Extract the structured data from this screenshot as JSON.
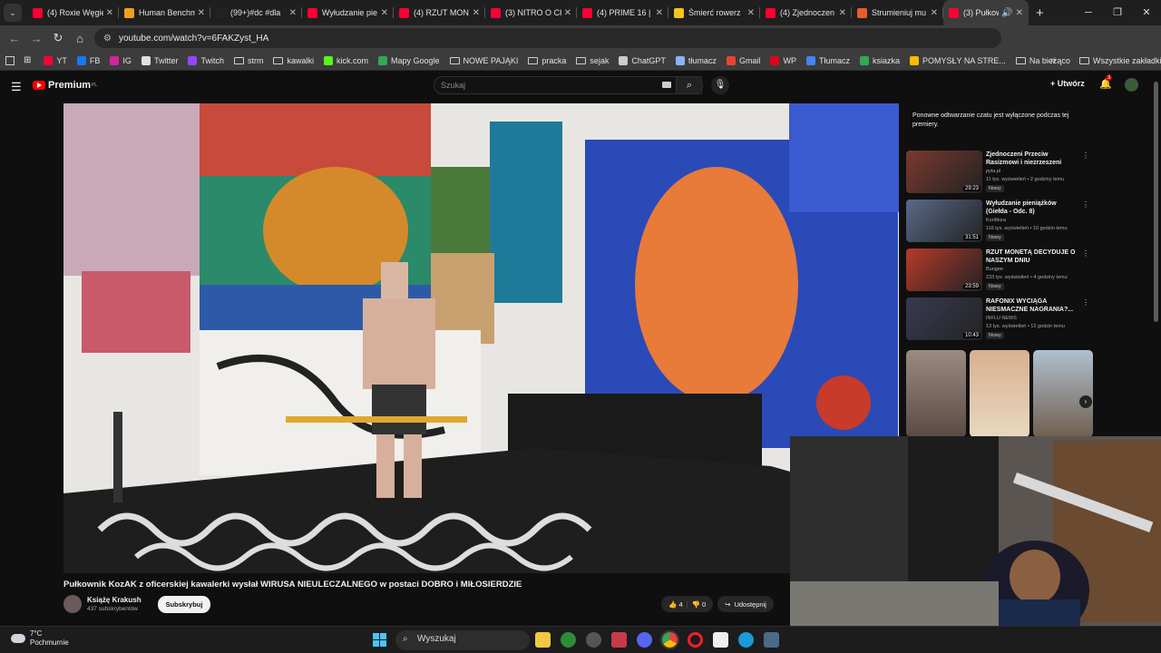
{
  "browser": {
    "tabs": [
      {
        "title": "(4) Roxie Węgie",
        "color": "#ff0033"
      },
      {
        "title": "Human Benchm",
        "color": "#f0a020"
      },
      {
        "title": "(99+)#dc #dla",
        "color": "#222222"
      },
      {
        "title": "Wyłudzanie pie",
        "color": "#ff0033"
      },
      {
        "title": "(4) RZUT MON",
        "color": "#ff0033"
      },
      {
        "title": "(3) NITRO O CH",
        "color": "#ff0033"
      },
      {
        "title": "(4) PRIME 16 |",
        "color": "#ff0033"
      },
      {
        "title": "Śmierć rowerz",
        "color": "#f5c518"
      },
      {
        "title": "(4) Zjednoczen",
        "color": "#ff0033"
      },
      {
        "title": "Strumieniuj mu",
        "color": "#e85d2a"
      },
      {
        "title": "(3) Pułkow",
        "color": "#ff0033"
      }
    ],
    "url": "youtube.com/watch?v=6FAKZyst_HA",
    "bookmarks": [
      {
        "label": "YT",
        "type": "icon",
        "color": "#ff0033"
      },
      {
        "label": "FB",
        "type": "icon",
        "color": "#1877f2"
      },
      {
        "label": "IG",
        "type": "icon",
        "color": "#d6249f"
      },
      {
        "label": "Twitter",
        "type": "icon",
        "color": "#e0e0e0"
      },
      {
        "label": "Twitch",
        "type": "icon",
        "color": "#9146ff"
      },
      {
        "label": "strm",
        "type": "folder"
      },
      {
        "label": "kawalki",
        "type": "folder"
      },
      {
        "label": "kick.com",
        "type": "icon",
        "color": "#53fc18"
      },
      {
        "label": "Mapy Google",
        "type": "icon",
        "color": "#34a853"
      },
      {
        "label": "NOWE PAJĄKI",
        "type": "folder"
      },
      {
        "label": "pracka",
        "type": "folder"
      },
      {
        "label": "sejak",
        "type": "folder"
      },
      {
        "label": "ChatGPT",
        "type": "icon",
        "color": "#cccccc"
      },
      {
        "label": "tłumacz",
        "type": "icon",
        "color": "#8ab4f8"
      },
      {
        "label": "Gmail",
        "type": "icon",
        "color": "#ea4335"
      },
      {
        "label": "WP",
        "type": "icon",
        "color": "#e2001a"
      },
      {
        "label": "Tłumacz",
        "type": "icon",
        "color": "#4285f4"
      },
      {
        "label": "ksiazka",
        "type": "icon",
        "color": "#34a853"
      },
      {
        "label": "POMYSŁY NA STRE...",
        "type": "icon",
        "color": "#fbbc04"
      },
      {
        "label": "Na bieżąco",
        "type": "folder"
      }
    ],
    "all_bookmarks": "Wszystkie zakładki"
  },
  "youtube": {
    "logo": "Premium",
    "logo_region": "PL",
    "search_placeholder": "Szukaj",
    "create_label": "Utwórz",
    "notification_count": "3",
    "video_title": "Pułkownik KozAK z oficerskiej kawalerki wysłał WIRUSA NIEULECZALNEGO w postaci DOBRO i MIŁOSIERDZIE",
    "channel_name": "Książę Krakush",
    "channel_subs": "437 subskrybentów",
    "subscribe_label": "Subskrybuj",
    "likes": "4",
    "dislikes": "0",
    "share_label": "Udostępnij",
    "replay_notice": "Ponowne odtwarzanie czatu jest wyłączone podczas tej premiery.",
    "recommendations": [
      {
        "title": "Zjednoczeni Przeciw Rasizmowi i niezrzeszeni",
        "channel": "pyta.pl",
        "meta": "11 tys. wyświetleń • 2 godziny temu",
        "duration": "29:23",
        "badge": "Nowy",
        "thumb": "#7a3a2e"
      },
      {
        "title": "Wyłudzanie pieniążków (Giełda - Odc. 8)",
        "channel": "Konfitura",
        "meta": "116 tys. wyświetleń • 10 godzin temu",
        "duration": "31:51",
        "badge": "Nowy",
        "thumb": "#5a6a8a"
      },
      {
        "title": "RZUT MONETĄ DECYDUJE O NASZYM DNIU",
        "channel": "Bungee",
        "meta": "233 tys. wyświetleń • 4 godziny temu",
        "duration": "23:59",
        "badge": "Nowy",
        "thumb": "#b83a2a"
      },
      {
        "title": "RAFONIX WYCIĄGA NIESMACZNE NAGRANIA?...",
        "channel": "INFLU NEWS",
        "meta": "13 tys. wyświetleń • 12 godzin temu",
        "duration": "10:43",
        "badge": "Nowy",
        "thumb": "#3a3a52"
      }
    ]
  },
  "taskbar": {
    "temperature": "7°C",
    "weather": "Pochmurnie",
    "search_label": "Wyszukaj"
  }
}
